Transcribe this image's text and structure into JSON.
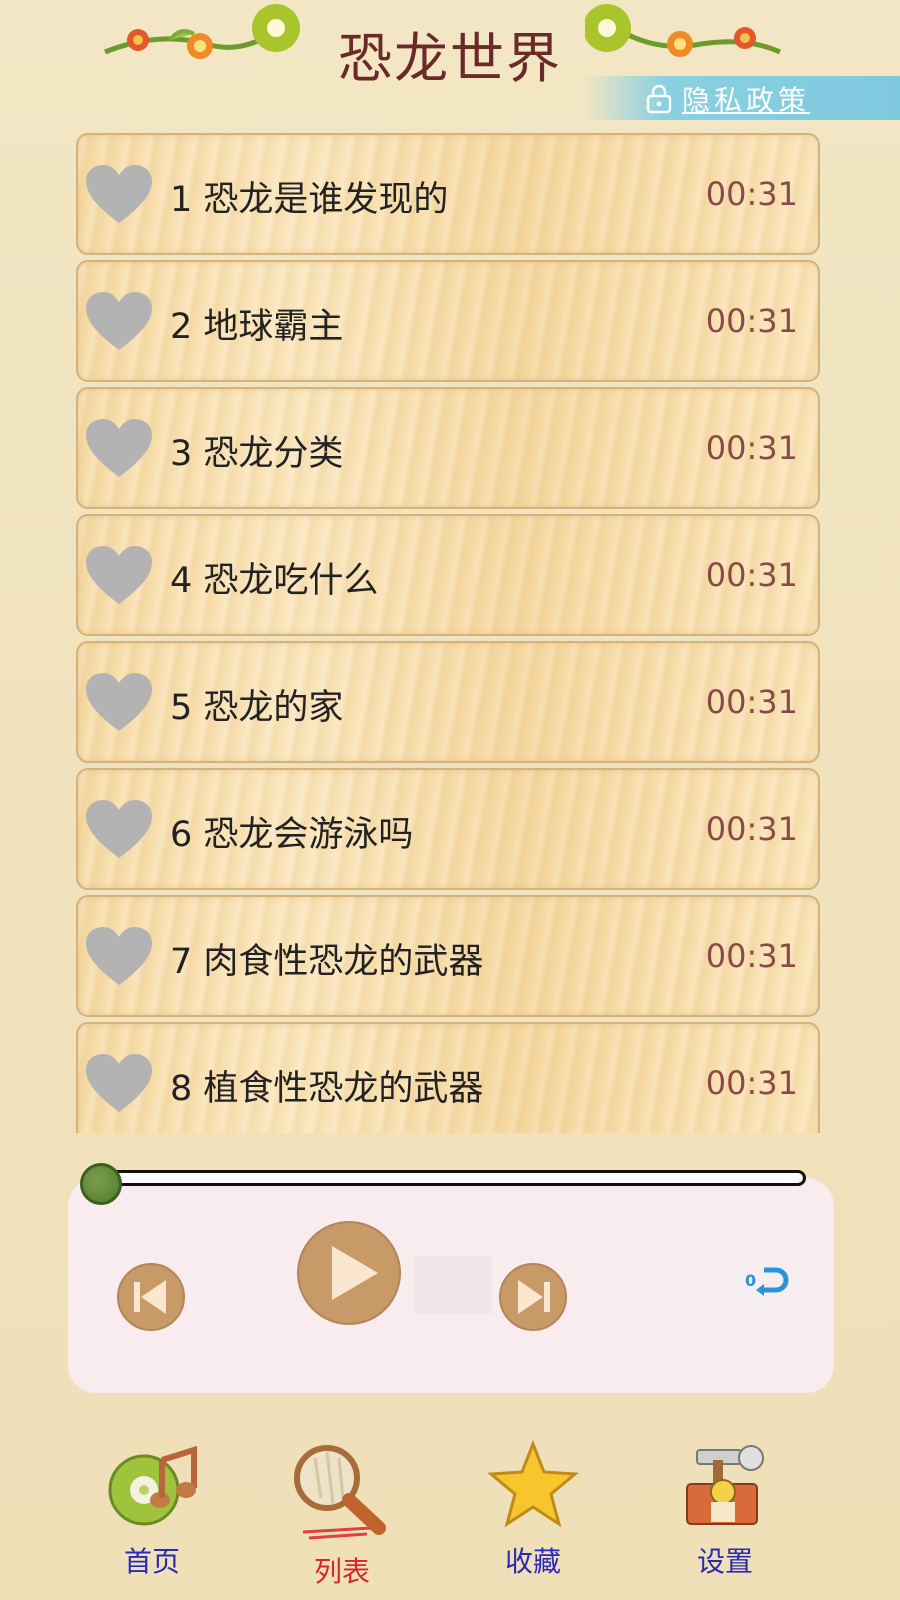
{
  "header": {
    "title": "恐龙世界",
    "privacy_label": "隐私政策"
  },
  "list": {
    "items": [
      {
        "label": "1 恐龙是谁发现的",
        "duration": "00:31"
      },
      {
        "label": "2 地球霸主",
        "duration": "00:31"
      },
      {
        "label": "3 恐龙分类",
        "duration": "00:31"
      },
      {
        "label": "4 恐龙吃什么",
        "duration": "00:31"
      },
      {
        "label": "5 恐龙的家",
        "duration": "00:31"
      },
      {
        "label": "6 恐龙会游泳吗",
        "duration": "00:31"
      },
      {
        "label": "7 肉食性恐龙的武器",
        "duration": "00:31"
      },
      {
        "label": "8 植食性恐龙的武器",
        "duration": "00:31"
      }
    ]
  },
  "player": {
    "progress": 0,
    "loop_badge": "0"
  },
  "nav": {
    "items": [
      {
        "label": "首页",
        "icon": "music-disc-icon",
        "color": "#2a2ab8"
      },
      {
        "label": "列表",
        "icon": "magnifier-icon",
        "color": "#d8262a",
        "active": true
      },
      {
        "label": "收藏",
        "icon": "star-icon",
        "color": "#2a2ab8"
      },
      {
        "label": "设置",
        "icon": "tools-icon",
        "color": "#2a2ab8"
      }
    ]
  },
  "colors": {
    "background": "#f0e2bd",
    "title": "#6b2a2a",
    "duration": "#8b4a4a",
    "privacy_bg": "#7fc9df",
    "nav_active": "#d8262a",
    "nav_inactive": "#2a2ab8"
  }
}
